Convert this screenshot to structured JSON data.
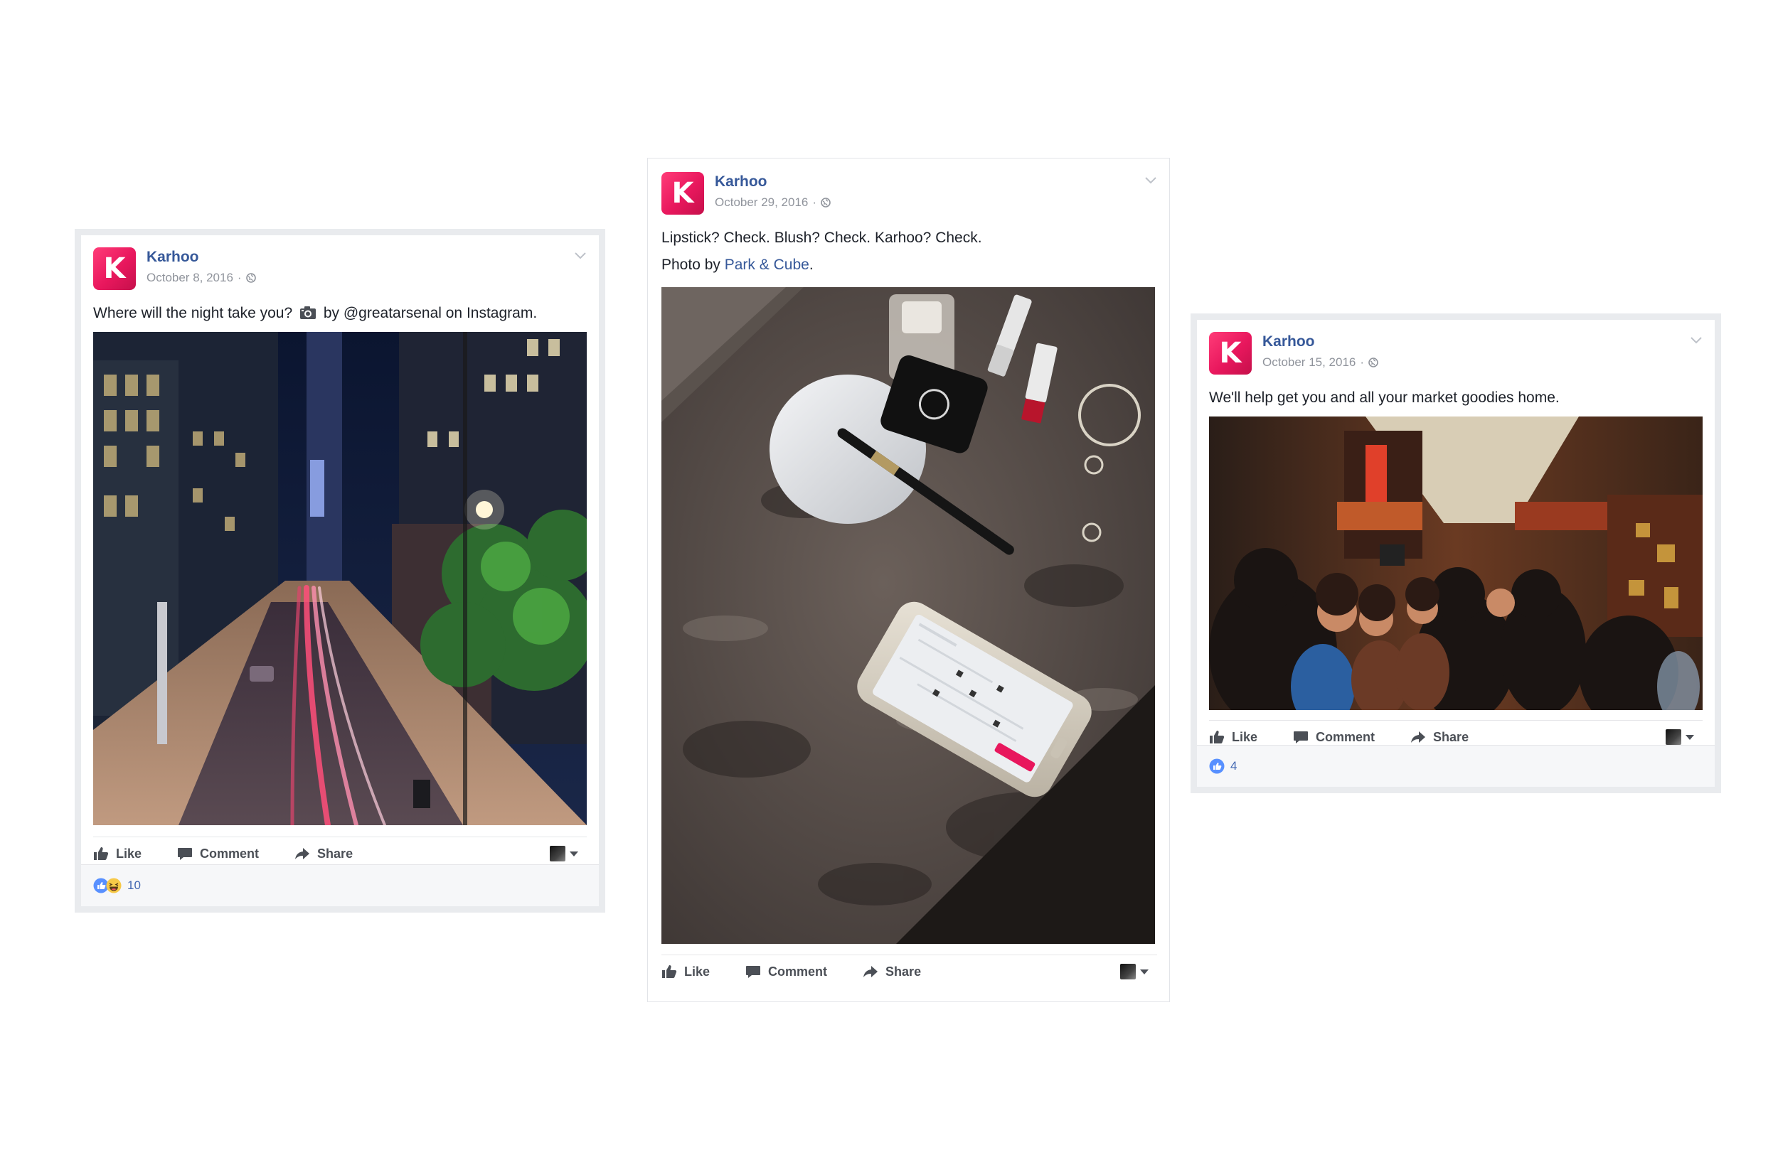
{
  "posts": [
    {
      "author": "Karhoo",
      "avatar_letter": "K",
      "date": "October 8, 2016",
      "text_before": "Where will the night take you?",
      "text_after": "by @greatarsenal on Instagram.",
      "photo_subject": "night-city-street-light-trails",
      "actions": {
        "like": "Like",
        "comment": "Comment",
        "share": "Share"
      },
      "reaction_count": "10",
      "reactions": [
        "like",
        "haha"
      ]
    },
    {
      "author": "Karhoo",
      "avatar_letter": "K",
      "date": "October 29, 2016",
      "line1": "Lipstick? Check. Blush? Check. Karhoo? Check.",
      "line2_prefix": "Photo by",
      "line2_link": "Park & Cube",
      "line2_suffix": ".",
      "photo_subject": "makeup-and-phone-on-marble",
      "actions": {
        "like": "Like",
        "comment": "Comment",
        "share": "Share"
      }
    },
    {
      "author": "Karhoo",
      "avatar_letter": "K",
      "date": "October 15, 2016",
      "text": "We'll help get you and all your market goodies home.",
      "photo_subject": "busy-street-market",
      "actions": {
        "like": "Like",
        "comment": "Comment",
        "share": "Share"
      },
      "reaction_count": "4",
      "reactions": [
        "like"
      ]
    }
  ],
  "colors": {
    "brand_pink": "#e8175d",
    "link_blue": "#365899",
    "meta_gray": "#90949c",
    "action_gray": "#4b4f56"
  }
}
